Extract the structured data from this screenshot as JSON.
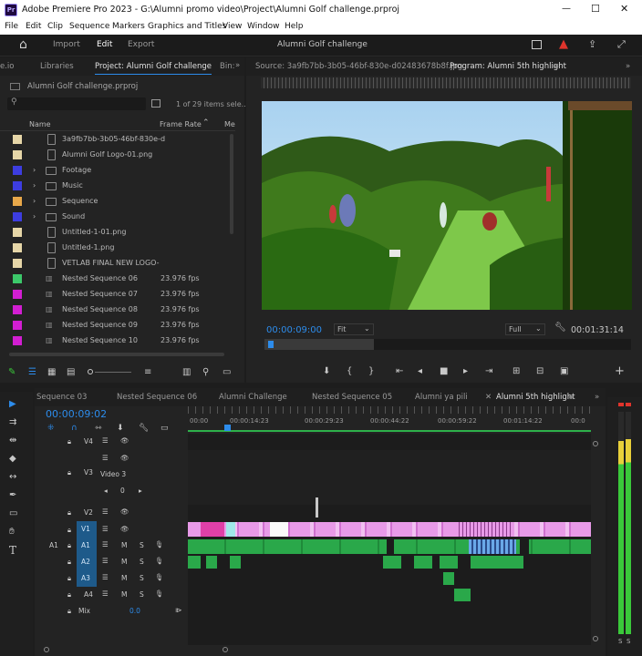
{
  "window": {
    "title": "Adobe Premiere Pro 2023 - G:\\Alumni promo video\\Project\\Alumni Golf challenge.prproj",
    "minimize": "—",
    "maximize": "☐",
    "close": "✕"
  },
  "menu": [
    "File",
    "Edit",
    "Clip",
    "Sequence",
    "Markers",
    "Graphics and Titles",
    "View",
    "Window",
    "Help"
  ],
  "header": {
    "home": "⌂",
    "tabs": [
      "Import",
      "Edit",
      "Export"
    ],
    "active_tab": "Edit",
    "project_title": "Alumni Golf challenge"
  },
  "project_panel": {
    "tabs": [
      "e.io",
      "Libraries",
      "Project: Alumni Golf challenge",
      "Bin:"
    ],
    "file": "Alumni Golf challenge.prproj",
    "item_count": "1 of 29 items sele...",
    "columns": {
      "name": "Name",
      "frame_rate": "Frame Rate",
      "media": "Me"
    },
    "items": [
      {
        "name": "3a9fb7bb-3b05-46bf-830e-d",
        "rate": "",
        "color": "#e6d6a8",
        "kind": "file"
      },
      {
        "name": "Alumni Golf Logo-01.png",
        "rate": "",
        "color": "#e6d6a8",
        "kind": "file"
      },
      {
        "name": "Footage",
        "rate": "",
        "color": "#3d3de0",
        "kind": "folder"
      },
      {
        "name": "Music",
        "rate": "",
        "color": "#3d3de0",
        "kind": "folder"
      },
      {
        "name": "Sequence",
        "rate": "",
        "color": "#e8a84a",
        "kind": "folder"
      },
      {
        "name": "Sound",
        "rate": "",
        "color": "#3d3de0",
        "kind": "folder"
      },
      {
        "name": "Untitled-1-01.png",
        "rate": "",
        "color": "#e6d6a8",
        "kind": "file"
      },
      {
        "name": "Untitled-1.png",
        "rate": "",
        "color": "#e6d6a8",
        "kind": "file"
      },
      {
        "name": "VETLAB FINAL NEW LOGO-",
        "rate": "",
        "color": "#e6d6a8",
        "kind": "file"
      },
      {
        "name": "Nested Sequence 06",
        "rate": "23.976 fps",
        "color": "#3cc86a",
        "kind": "seq"
      },
      {
        "name": "Nested Sequence 07",
        "rate": "23.976 fps",
        "color": "#d21ed2",
        "kind": "seq"
      },
      {
        "name": "Nested Sequence 08",
        "rate": "23.976 fps",
        "color": "#d21ed2",
        "kind": "seq"
      },
      {
        "name": "Nested Sequence 09",
        "rate": "23.976 fps",
        "color": "#d21ed2",
        "kind": "seq"
      },
      {
        "name": "Nested Sequence 10",
        "rate": "23.976 fps",
        "color": "#d21ed2",
        "kind": "seq"
      }
    ]
  },
  "monitor": {
    "source_tab": "Source: 3a9fb7bb-3b05-46bf-830e-d02483678b8f.jpg",
    "program_tab": "Program: Alumni 5th highlight",
    "timecode": "00:00:09:00",
    "fit": "Fit",
    "quality": "Full",
    "duration": "00:01:31:14"
  },
  "timeline": {
    "tabs": [
      "Sequence 03",
      "Nested Sequence 06",
      "Alumni Challenge",
      "Nested Sequence 05",
      "Alumni ya pili",
      "Alumni 5th highlight"
    ],
    "active_tab": "Alumni 5th highlight",
    "timecode": "00:00:09:02",
    "ruler": [
      "00:00",
      "00:00:14:23",
      "00:00:29:23",
      "00:00:44:22",
      "00:00:59:22",
      "00:01:14:22",
      "00:0"
    ],
    "video_tracks": [
      "V4",
      "V3",
      "V2",
      "V1"
    ],
    "video3_label": "Video 3",
    "video3_value": "0",
    "audio_tracks": [
      "A1",
      "A2",
      "A3",
      "A4"
    ],
    "a1_source": "A1",
    "v1_source": "V1",
    "mix_label": "Mix",
    "mix_value": "0.0",
    "m_label": "M",
    "s_label": "S"
  },
  "meter": {
    "labels": [
      "S",
      "S"
    ]
  },
  "colors": {
    "accent": "#2d8ceb",
    "video_clip": "#e89ae8",
    "audio_clip": "#2aa84a",
    "label_blue": "#1e5a8a"
  }
}
